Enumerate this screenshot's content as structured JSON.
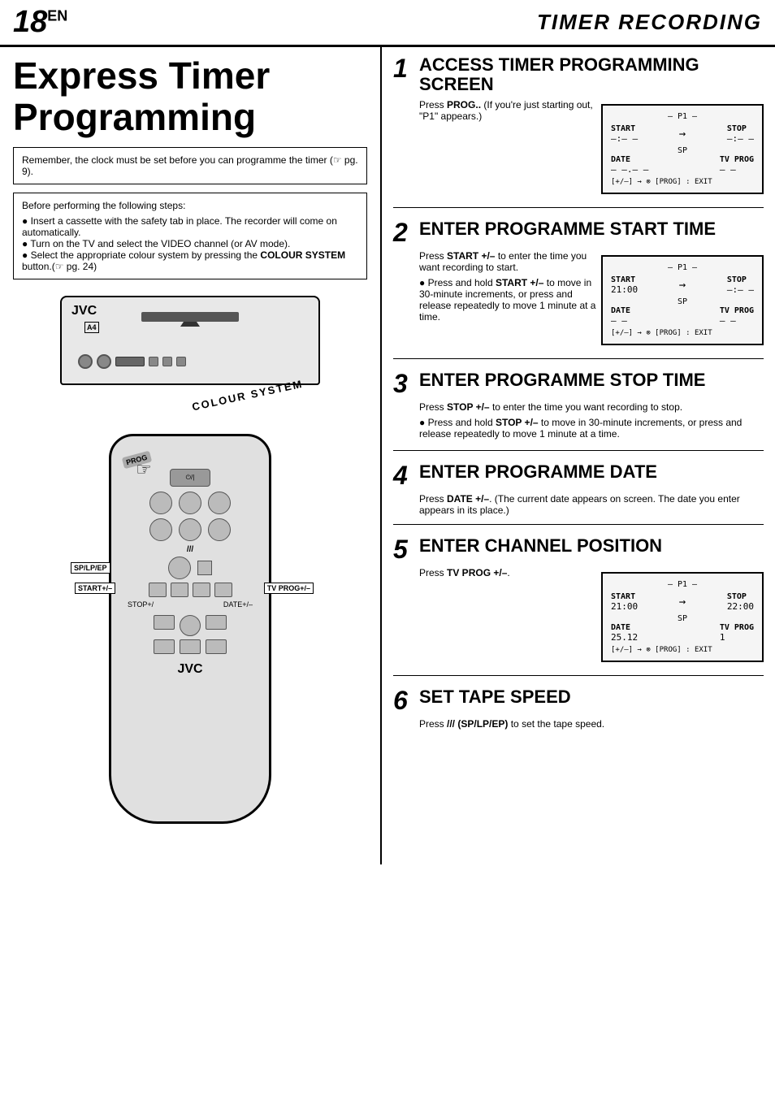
{
  "header": {
    "page_number": "18",
    "page_suffix": "EN",
    "section_title": "TIMER RECORDING"
  },
  "left": {
    "title": "Express Timer Programming",
    "info_box": {
      "text": "Remember, the clock must be set before you can programme the timer (☞ pg. 9)."
    },
    "steps_box": {
      "intro": "Before performing the following steps:",
      "items": [
        "Insert a cassette with the safety tab in place. The recorder will come on automatically.",
        "Turn on the TV and select the VIDEO channel (or AV mode).",
        "Select the appropriate colour system by pressing the COLOUR SYSTEM button.(☞ pg. 24)"
      ]
    },
    "vcr_label": "JVC",
    "vcr_sublabel": "A4",
    "colour_system": "COLOUR SYSTEM",
    "remote_prog": "PROG",
    "remote_sp": "SP/LP/EP",
    "remote_start": "START+/–",
    "remote_tvprog": "TV PROG+/–",
    "remote_stop": "STOP+/",
    "remote_date": "DATE+/–",
    "remote_jvc": "JVC"
  },
  "right": {
    "steps": [
      {
        "number": "1",
        "title": "ACCESS TIMER PROGRAMMING SCREEN",
        "body": "Press PROG.. (If you're just starting out, \"P1\" appears.)",
        "display": {
          "p1_label": "– P1 –",
          "start_label": "START",
          "start_value": "–:– –",
          "arrow": "→",
          "stop_label": "STOP",
          "stop_value": "–:– –",
          "sp_label": "SP",
          "date_label": "DATE",
          "date_value": "– –.– –",
          "tvprog_label": "TV PROG",
          "tvprog_value": "– –",
          "footer": "[+/–] → ⊗ [PROG] : EXIT"
        },
        "bullets": []
      },
      {
        "number": "2",
        "title": "ENTER PROGRAMME START TIME",
        "body": "Press START +/– to enter the time you want recording to start.",
        "display": {
          "p1_label": "– P1 –",
          "start_label": "START",
          "start_value": "21:00",
          "arrow": "→",
          "stop_label": "STOP",
          "stop_value": "–:– –",
          "sp_label": "SP",
          "date_label": "DATE",
          "date_value": "– –",
          "tvprog_label": "TV PROG",
          "tvprog_value": "– –",
          "footer": "[+/–] → ⊗ [PROG] : EXIT"
        },
        "bullets": [
          "Press and hold START +/– to move in 30-minute increments, or press and release repeatedly to move 1 minute at a time."
        ]
      },
      {
        "number": "3",
        "title": "ENTER PROGRAMME STOP TIME",
        "body": "Press STOP +/– to enter the time you want recording to stop.",
        "display": null,
        "bullets": [
          "Press and hold STOP +/– to move in 30-minute increments, or press and release repeatedly to move 1 minute at a time."
        ]
      },
      {
        "number": "4",
        "title": "ENTER PROGRAMME DATE",
        "body": "Press DATE +/–. (The current date appears on screen. The date you enter appears in its place.)",
        "display": null,
        "bullets": []
      },
      {
        "number": "5",
        "title": "ENTER CHANNEL POSITION",
        "body": "Press TV PROG +/–.",
        "display": {
          "p1_label": "– P1 –",
          "start_label": "START",
          "start_value": "21:00",
          "arrow": "→",
          "stop_label": "STOP",
          "stop_value": "22:00",
          "sp_label": "SP",
          "date_label": "DATE",
          "date_value": "25.12",
          "tvprog_label": "TV PROG",
          "tvprog_value": "1",
          "footer": "[+/–] → ⊗ [PROG] : EXIT"
        },
        "bullets": []
      },
      {
        "number": "6",
        "title": "SET TAPE SPEED",
        "body": "Press /// (SP/LP/EP) to set the tape speed.",
        "display": null,
        "bullets": []
      }
    ]
  }
}
